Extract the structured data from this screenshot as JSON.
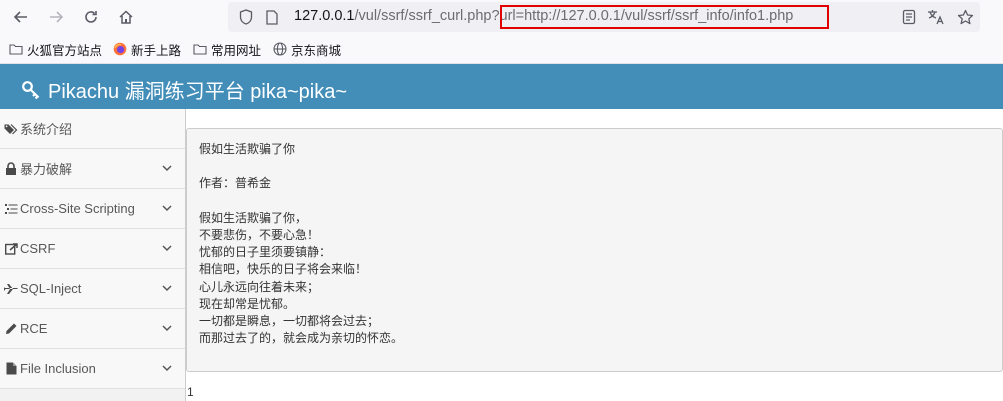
{
  "browser": {
    "url_host": "127.0.0.1",
    "url_path": "/vul/ssrf/ssrf_curl.php?url=http://127.0.0.1/vul/ssrf/ssrf_info/info1.php"
  },
  "bookmarks": [
    {
      "label": "火狐官方站点"
    },
    {
      "label": "新手上路"
    },
    {
      "label": "常用网址"
    },
    {
      "label": "京东商城"
    }
  ],
  "header": {
    "title": "Pikachu 漏洞练习平台 pika~pika~"
  },
  "sidebar": {
    "items": [
      {
        "label": "系统介绍"
      },
      {
        "label": "暴力破解"
      },
      {
        "label": "Cross-Site Scripting"
      },
      {
        "label": "CSRF"
      },
      {
        "label": "SQL-Inject"
      },
      {
        "label": "RCE"
      },
      {
        "label": "File Inclusion"
      }
    ]
  },
  "content": {
    "poem": "假如生活欺骗了你\n\n作者：普希金\n\n假如生活欺骗了你，\n不要悲伤，不要心急！\n忧郁的日子里须要镇静：\n相信吧，快乐的日子将会来临！\n心儿永远向往着未来；\n现在却常是忧郁。\n一切都是瞬息，一切都将会过去；\n而那过去了的，就会成为亲切的怀恋。",
    "footer_text": "1"
  }
}
